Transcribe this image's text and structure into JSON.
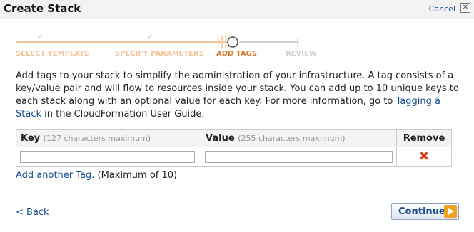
{
  "window": {
    "title": "Create Stack",
    "cancel_label": "Cancel",
    "close_glyph": "✕"
  },
  "wizard": {
    "steps": [
      {
        "label": "SELECT TEMPLATE",
        "status": "done"
      },
      {
        "label": "SPECIFY PARAMETERS",
        "status": "done"
      },
      {
        "label": "ADD TAGS",
        "status": "current"
      },
      {
        "label": "REVIEW",
        "status": "future"
      }
    ],
    "done_mark": "✓"
  },
  "description": {
    "text_before": "Add tags to your stack to simplify the administration of your infrastructure. A tag consists of a key/value pair and will flow to resources inside your stack. You can add up to 10 unique keys to each stack along with an optional value for each key. For more information, go to ",
    "link_text": "Tagging a Stack",
    "text_after": " in the CloudFormation User Guide."
  },
  "tags_table": {
    "columns": {
      "key": "Key",
      "key_hint": "(127 characters maximum)",
      "value": "Value",
      "value_hint": "(255 characters maximum)",
      "remove": "Remove"
    },
    "rows": [
      {
        "key": "",
        "value": ""
      }
    ],
    "remove_glyph": "✖"
  },
  "add_tag": {
    "link_text": "Add another Tag.",
    "note": " (Maximum of 10)"
  },
  "footer": {
    "back_label": "< Back",
    "continue_label": "Continue"
  },
  "colors": {
    "link": "#1a4e8f",
    "step_current": "#d97b2e",
    "step_done": "#f2c49a",
    "step_future": "#cfcfcf",
    "remove_icon": "#d23c16",
    "continue_arrow": "#f0a21e"
  }
}
